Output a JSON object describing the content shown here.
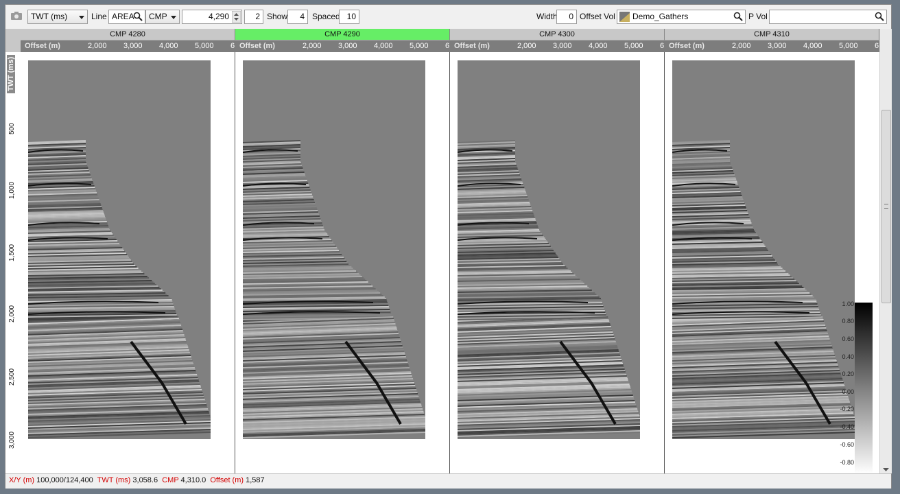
{
  "toolbar": {
    "domain_select": "TWT (ms)",
    "line_label": "Line",
    "line_type": "AREA",
    "key_select": "CMP",
    "key_value": "4,290",
    "increment": "2",
    "show_label": "Show",
    "show_value": "4",
    "spaced_label": "Spaced",
    "spaced_value": "10",
    "width_label": "Width",
    "width_value": "0",
    "offset_vol_label": "Offset Vol",
    "offset_vol_value": "Demo_Gathers",
    "pvol_label": "P Vol",
    "pvol_value": ""
  },
  "gathers": [
    {
      "title": "CMP 4280",
      "active": false
    },
    {
      "title": "CMP 4290",
      "active": true
    },
    {
      "title": "CMP 4300",
      "active": false
    },
    {
      "title": "CMP 4310",
      "active": false
    }
  ],
  "offset_axis": {
    "label": "Offset (m)",
    "ticks": [
      "2,000",
      "3,000",
      "4,000",
      "5,000",
      "6"
    ]
  },
  "twt_axis": {
    "label": "TWT (ms)",
    "ticks": [
      "500",
      "1,000",
      "1,500",
      "2,000",
      "2,500",
      "3,000"
    ]
  },
  "colorbar": {
    "labels": [
      "1.00",
      "0.80",
      "0.60",
      "0.40",
      "0.20",
      "0.00",
      "-0.20",
      "-0.40",
      "-0.60",
      "-0.80"
    ]
  },
  "status": {
    "xy_label": "X/Y (m)",
    "xy_value": "100,000/124,400",
    "twt_label": "TWT (ms)",
    "twt_value": "3,058.6",
    "cmp_label": "CMP",
    "cmp_value": "4,310.0",
    "offset_label": "Offset (m)",
    "offset_value": "1,587"
  }
}
